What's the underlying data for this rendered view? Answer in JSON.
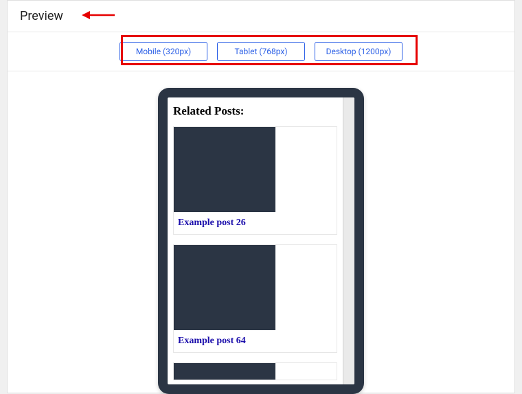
{
  "header": {
    "title": "Preview"
  },
  "buttons": {
    "mobile": "Mobile (320px)",
    "tablet": "Tablet (768px)",
    "desktop": "Desktop (1200px)"
  },
  "preview": {
    "related_heading": "Related Posts:",
    "posts": [
      {
        "title": "Example post 26"
      },
      {
        "title": "Example post 64"
      },
      {
        "title": ""
      }
    ]
  }
}
